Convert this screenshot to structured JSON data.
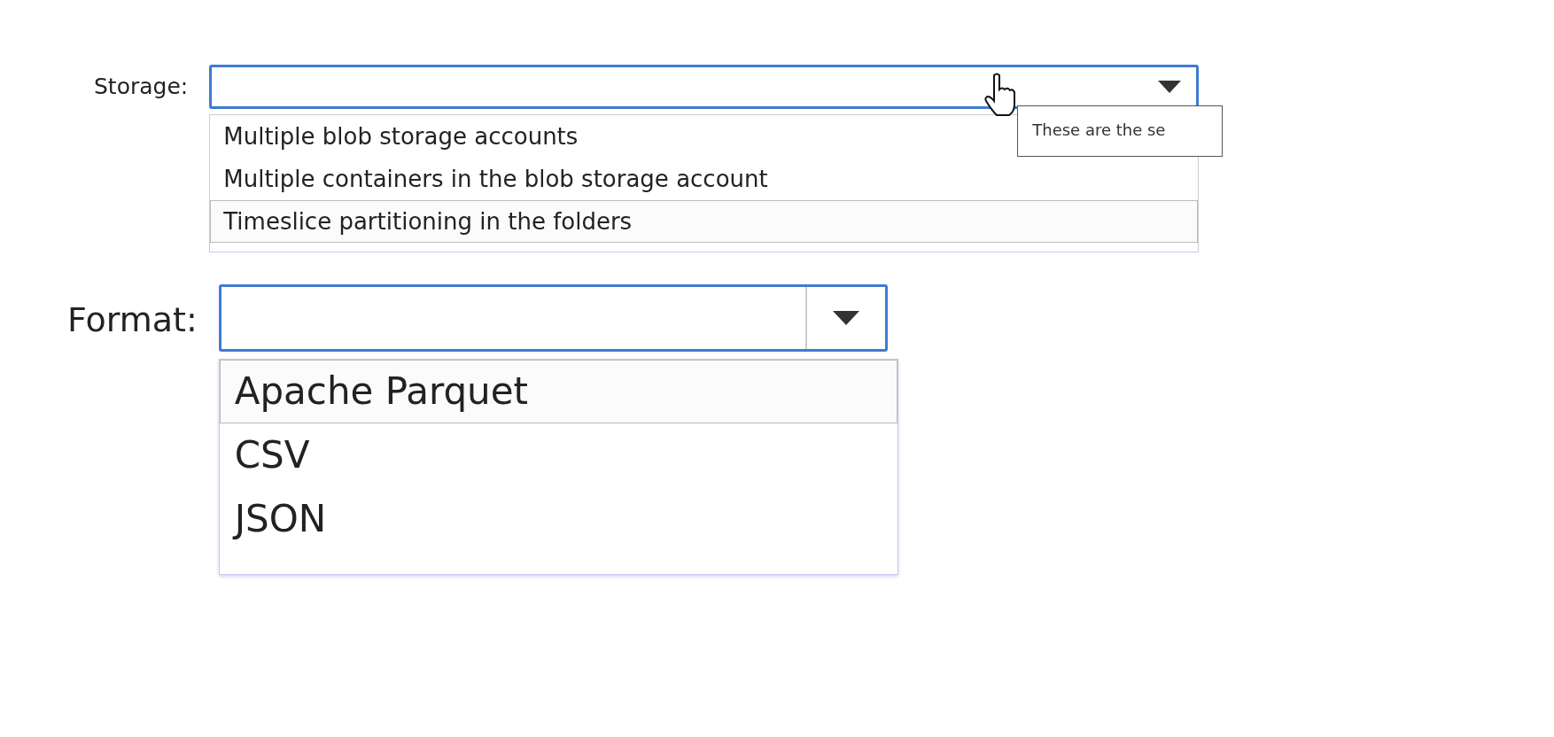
{
  "storage": {
    "label": "Storage:",
    "options": [
      {
        "label": "Multiple blob storage accounts",
        "selected": false
      },
      {
        "label": "Multiple containers in the blob storage account",
        "selected": false
      },
      {
        "label": "Timeslice partitioning in the folders",
        "selected": true
      }
    ],
    "tooltip": "These are the se"
  },
  "format": {
    "label": "Format:",
    "options": [
      {
        "label": "Apache Parquet",
        "selected": true
      },
      {
        "label": "CSV",
        "selected": false
      },
      {
        "label": "JSON",
        "selected": false
      }
    ]
  }
}
